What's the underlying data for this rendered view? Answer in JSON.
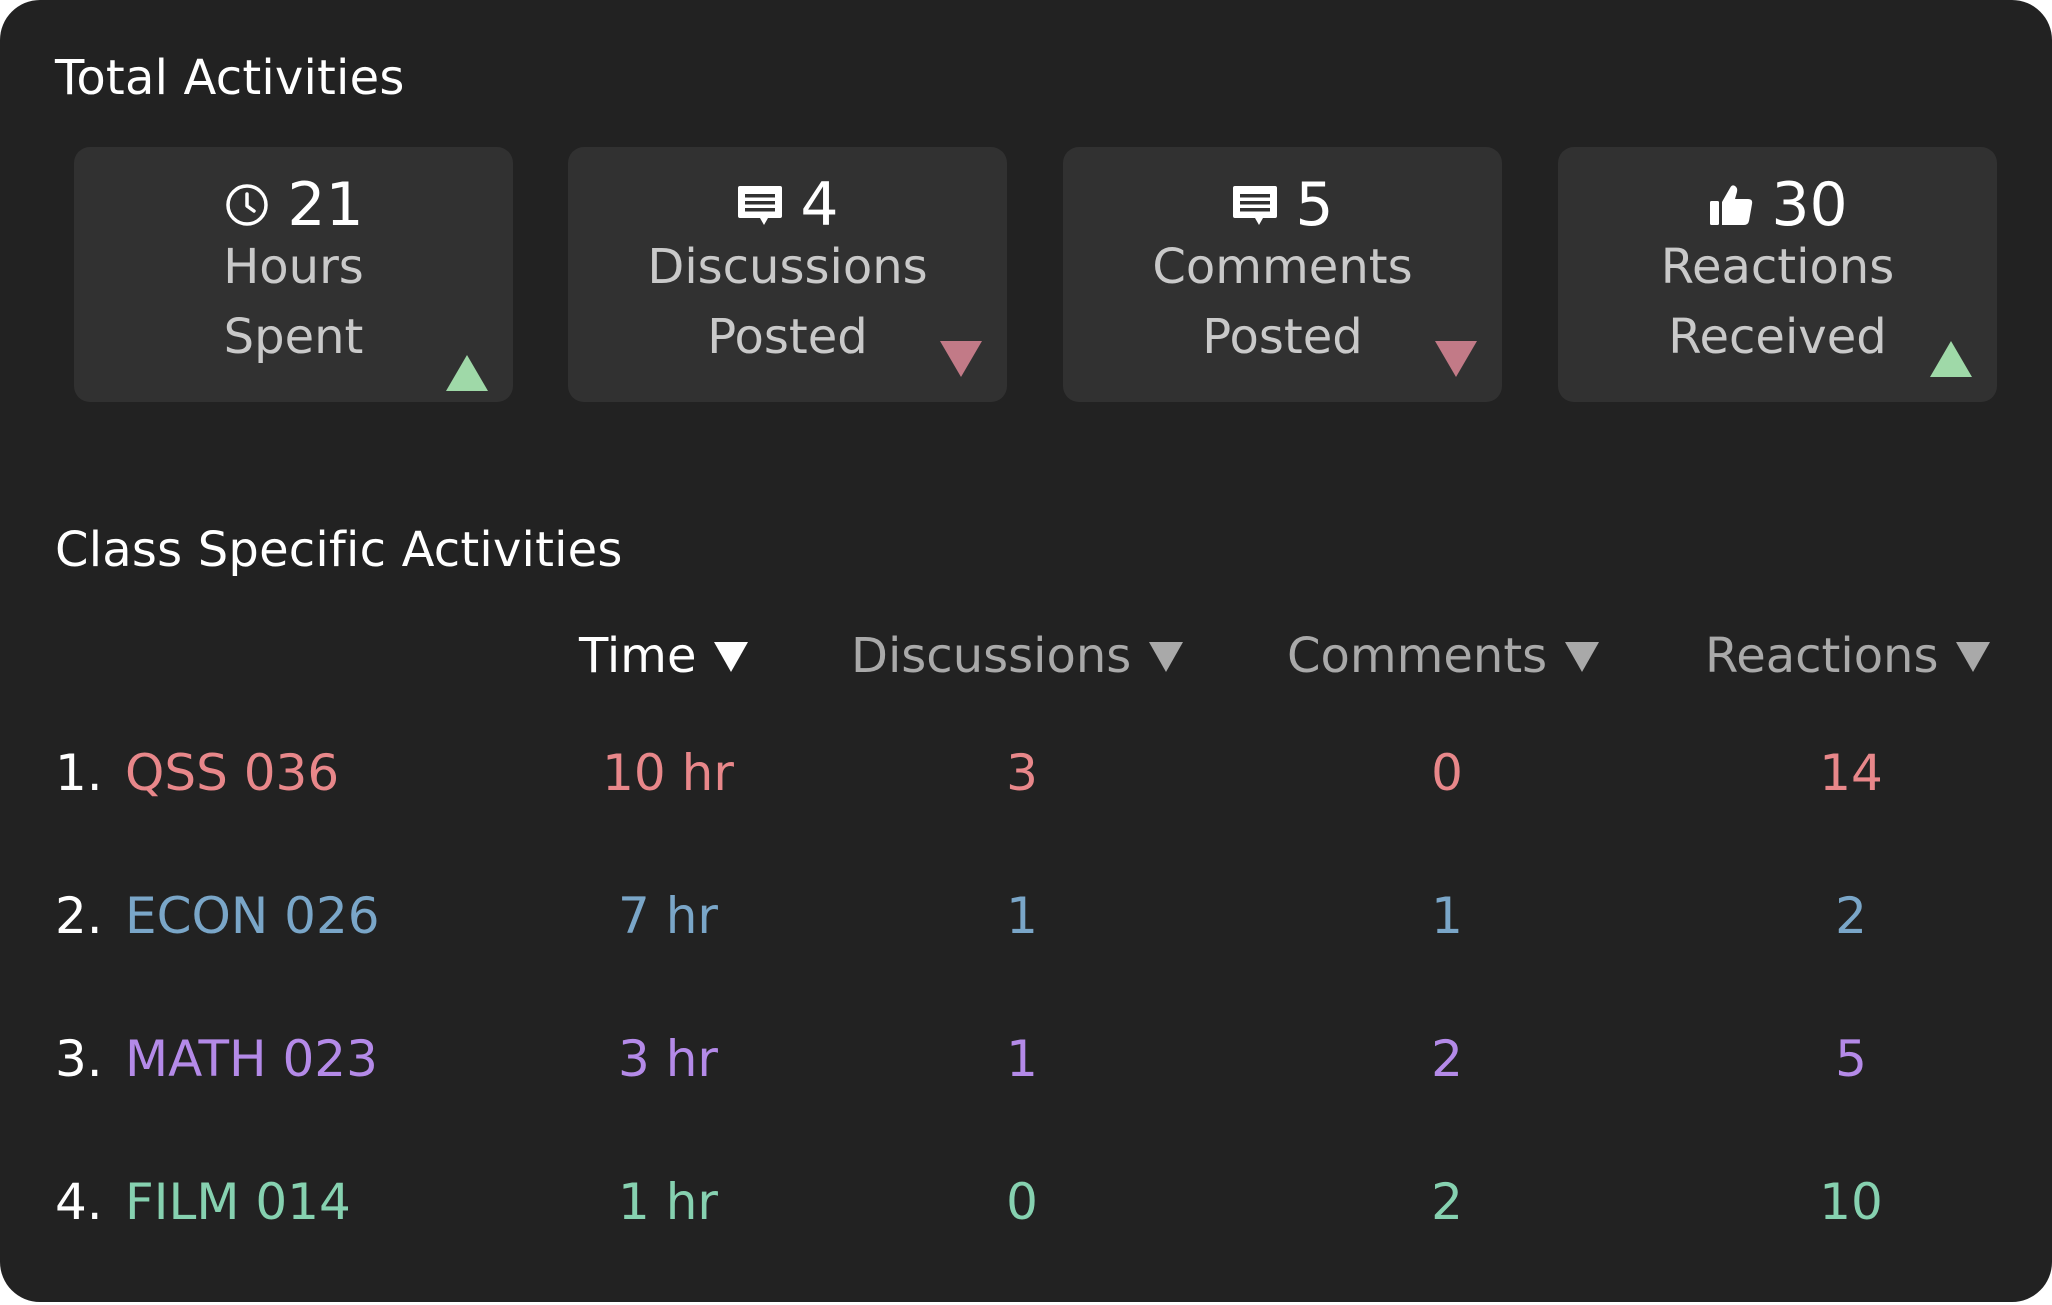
{
  "total_activities": {
    "title": "Total Activities",
    "cards": [
      {
        "icon": "clock-icon",
        "value": "21",
        "label_line1": "Hours",
        "label_line2": "Spent",
        "trend": "up"
      },
      {
        "icon": "chat-bubble-icon",
        "value": "4",
        "label_line1": "Discussions",
        "label_line2": "Posted",
        "trend": "down"
      },
      {
        "icon": "chat-bubble-icon",
        "value": "5",
        "label_line1": "Comments",
        "label_line2": "Posted",
        "trend": "down"
      },
      {
        "icon": "thumbs-up-icon",
        "value": "30",
        "label_line1": "Reactions",
        "label_line2": "Received",
        "trend": "up"
      }
    ]
  },
  "class_activities": {
    "title": "Class Specific Activities",
    "columns": [
      {
        "label": "Time",
        "active": true
      },
      {
        "label": "Discussions",
        "active": false
      },
      {
        "label": "Comments",
        "active": false
      },
      {
        "label": "Reactions",
        "active": false
      }
    ],
    "rows": [
      {
        "rank": "1.",
        "course": "QSS 036",
        "time": "10 hr",
        "discussions": "3",
        "comments": "0",
        "reactions": "14",
        "color": "#e8878a"
      },
      {
        "rank": "2.",
        "course": "ECON 026",
        "time": "7 hr",
        "discussions": "1",
        "comments": "1",
        "reactions": "2",
        "color": "#7aa6c8"
      },
      {
        "rank": "3.",
        "course": "MATH 023",
        "time": "3 hr",
        "discussions": "1",
        "comments": "2",
        "reactions": "5",
        "color": "#b48ae8"
      },
      {
        "rank": "4.",
        "course": "FILM 014",
        "time": "1 hr",
        "discussions": "0",
        "comments": "2",
        "reactions": "10",
        "color": "#86d1b0"
      }
    ]
  },
  "colors": {
    "panel": "#222222",
    "card": "#313131",
    "trend_up": "#9fd9a8",
    "trend_down": "#c27a87"
  }
}
